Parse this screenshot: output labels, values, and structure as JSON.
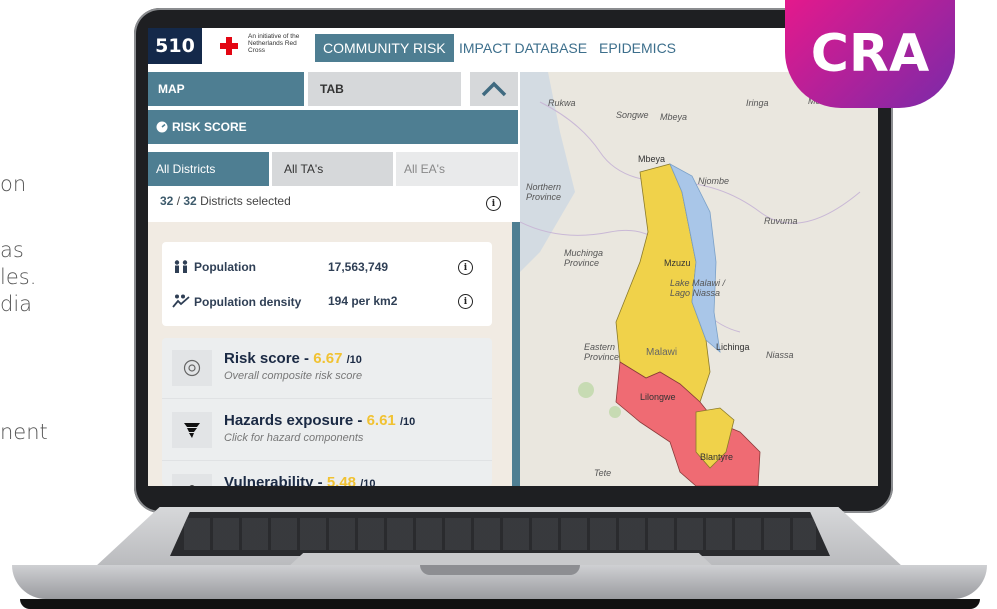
{
  "left_text": [
    "on",
    "as",
    "les.",
    "dia",
    "nent"
  ],
  "nav": {
    "logo": "510",
    "initiative": "An initiative of the Netherlands Red Cross",
    "tabs": [
      "COMMUNITY RISK",
      "IMPACT DATABASE",
      "EPIDEMICS"
    ]
  },
  "panel": {
    "map_label": "MAP",
    "tab_label": "TAB",
    "risk_header": "RISK SCORE",
    "segments": [
      "All Districts",
      "All TA's",
      "All EA's"
    ],
    "selected_count": "32",
    "selected_total": "32",
    "selected_label": "Districts selected",
    "population": {
      "label": "Population",
      "value": "17,563,749"
    },
    "density": {
      "label": "Population density",
      "value": "194 per km2"
    },
    "scores": [
      {
        "title": "Risk score",
        "value": "6.67",
        "out_of": "/10",
        "subtitle": "Overall composite risk score",
        "icon": "target-icon"
      },
      {
        "title": "Hazards exposure",
        "value": "6.61",
        "out_of": "/10",
        "subtitle": "Click for hazard components",
        "icon": "tornado-icon"
      },
      {
        "title": "Vulnerability",
        "value": "5.48",
        "out_of": "/10",
        "subtitle": "",
        "icon": "people-icon"
      }
    ]
  },
  "map_labels": [
    "Rukwa",
    "Songwe",
    "Mbeya",
    "Iringa",
    "Morogoro",
    "Mbeya",
    "Njombe",
    "Northern Province",
    "Ruvuma",
    "Muchinga Province",
    "Mzuzu",
    "Lake Malawi / Lago Niassa",
    "Eastern Province",
    "Malawi",
    "Lichinga",
    "Niassa",
    "Lilongwe",
    "Tete",
    "Blantyre"
  ],
  "badge": "CRA",
  "colors": {
    "accent": "#4e7e92",
    "navy": "#14294a",
    "red_cross": "#e30613",
    "score_value": "#f1c232",
    "map_yellow": "#f0d24a",
    "map_red": "#ef6b73",
    "lake": "#a9c6e8"
  }
}
